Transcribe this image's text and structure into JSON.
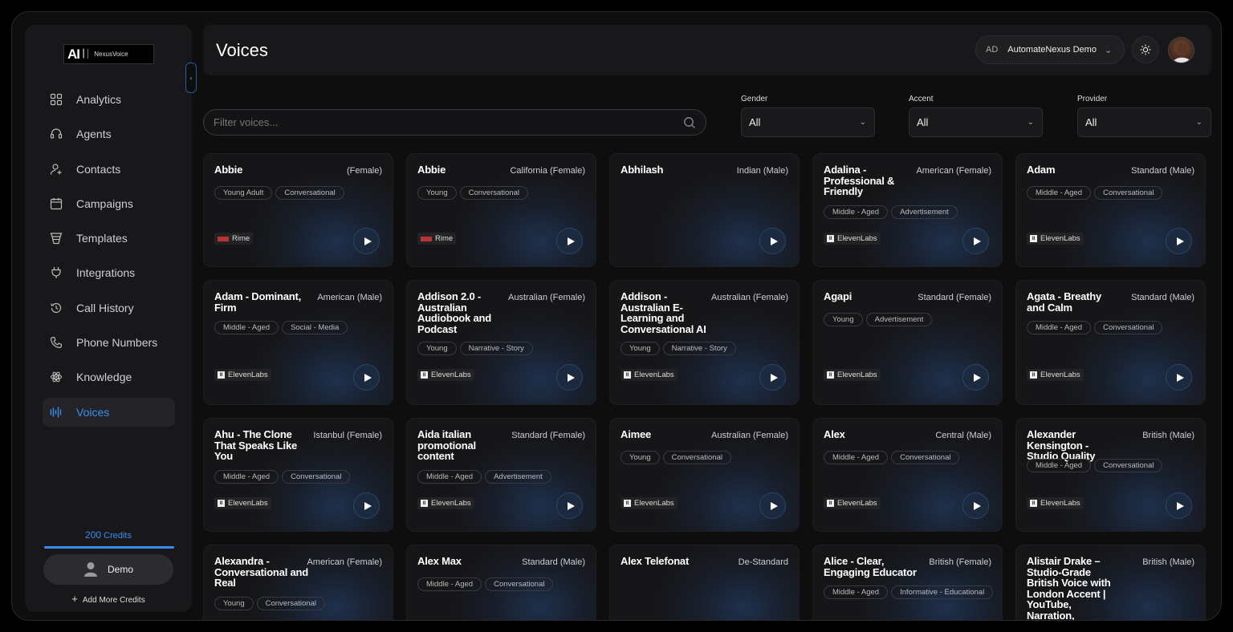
{
  "app": {
    "logo_text": "NexusVoice",
    "logo_mark": "AI",
    "page_title": "Voices",
    "account_initials": "AD",
    "account_name": "AutomateNexus Demo"
  },
  "sidebar": {
    "items": [
      {
        "label": "Analytics",
        "icon": "grid-icon"
      },
      {
        "label": "Agents",
        "icon": "headset-icon"
      },
      {
        "label": "Contacts",
        "icon": "user-plus-icon"
      },
      {
        "label": "Campaigns",
        "icon": "calendar-icon"
      },
      {
        "label": "Templates",
        "icon": "funnel-icon"
      },
      {
        "label": "Integrations",
        "icon": "plug-icon"
      },
      {
        "label": "Call History",
        "icon": "history-icon"
      },
      {
        "label": "Phone Numbers",
        "icon": "phone-icon"
      },
      {
        "label": "Knowledge",
        "icon": "atom-icon"
      },
      {
        "label": "Voices",
        "icon": "waveform-icon",
        "active": true
      }
    ],
    "credits_value": "200",
    "credits_unit": "Credits",
    "user_name": "Demo",
    "add_credits_label": "Add More Credits"
  },
  "filters": {
    "search_placeholder": "Filter voices...",
    "gender_label": "Gender",
    "gender_value": "All",
    "accent_label": "Accent",
    "accent_value": "All",
    "provider_label": "Provider",
    "provider_value": "All"
  },
  "voices": [
    {
      "name": "Abbie",
      "meta": "(Female)",
      "tags": [
        "Young Adult",
        "Conversational"
      ],
      "provider": "Rime"
    },
    {
      "name": "Abbie",
      "meta": "California (Female)",
      "tags": [
        "Young",
        "Conversational"
      ],
      "provider": "Rime"
    },
    {
      "name": "Abhilash",
      "meta": "Indian (Male)",
      "tags": [],
      "provider": ""
    },
    {
      "name": "Adalina - Professional & Friendly",
      "meta": "American (Female)",
      "tags": [
        "Middle - Aged",
        "Advertisement"
      ],
      "provider": "ElevenLabs"
    },
    {
      "name": "Adam",
      "meta": "Standard (Male)",
      "tags": [
        "Middle - Aged",
        "Conversational"
      ],
      "provider": "ElevenLabs"
    },
    {
      "name": "Adam - Dominant, Firm",
      "meta": "American (Male)",
      "tags": [
        "Middle - Aged",
        "Social - Media"
      ],
      "provider": "ElevenLabs"
    },
    {
      "name": "Addison 2.0 - Australian Audiobook and Podcast",
      "meta": "Australian (Female)",
      "tags": [
        "Young",
        "Narrative - Story"
      ],
      "provider": "ElevenLabs"
    },
    {
      "name": "Addison - Australian E-Learning and Conversational AI",
      "meta": "Australian (Female)",
      "tags": [
        "Young",
        "Narrative - Story"
      ],
      "provider": "ElevenLabs"
    },
    {
      "name": "Agapi",
      "meta": "Standard (Female)",
      "tags": [
        "Young",
        "Advertisement"
      ],
      "provider": "ElevenLabs"
    },
    {
      "name": "Agata - Breathy and Calm",
      "meta": "Standard (Male)",
      "tags": [
        "Middle - Aged",
        "Conversational"
      ],
      "provider": "ElevenLabs"
    },
    {
      "name": "Ahu - The Clone That Speaks Like You",
      "meta": "Istanbul (Female)",
      "tags": [
        "Middle - Aged",
        "Conversational"
      ],
      "provider": "ElevenLabs"
    },
    {
      "name": "Aida italian promotional content",
      "meta": "Standard (Female)",
      "tags": [
        "Middle - Aged",
        "Advertisement"
      ],
      "provider": "ElevenLabs"
    },
    {
      "name": "Aimee",
      "meta": "Australian (Female)",
      "tags": [
        "Young",
        "Conversational"
      ],
      "provider": "ElevenLabs"
    },
    {
      "name": "Alex",
      "meta": "Central (Male)",
      "tags": [
        "Middle - Aged",
        "Conversational"
      ],
      "provider": "ElevenLabs"
    },
    {
      "name": "Alexander Kensington - Studio Quality",
      "meta": "British (Male)",
      "tags": [
        "Middle - Aged",
        "Conversational"
      ],
      "provider": "ElevenLabs"
    },
    {
      "name": "Alexandra - Conversational and Real",
      "meta": "American (Female)",
      "tags": [
        "Young",
        "Conversational"
      ],
      "provider": ""
    },
    {
      "name": "Alex Max",
      "meta": "Standard (Male)",
      "tags": [
        "Middle - Aged",
        "Conversational"
      ],
      "provider": ""
    },
    {
      "name": "Alex Telefonat",
      "meta": "De-Standard",
      "tags": [],
      "provider": ""
    },
    {
      "name": "Alice - Clear, Engaging Educator",
      "meta": "British (Female)",
      "tags": [
        "Middle - Aged",
        "Informative - Educational"
      ],
      "provider": ""
    },
    {
      "name": "Alistair Drake – Studio-Grade British Voice with London Accent | YouTube, Narration, Audiobooks",
      "meta": "British (Male)",
      "tags": [],
      "provider": ""
    }
  ]
}
